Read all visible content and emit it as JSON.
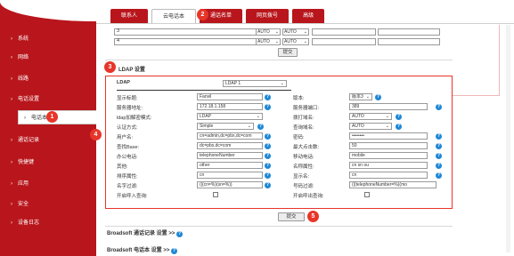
{
  "sidebar": {
    "items": [
      {
        "label": "系统",
        "arrow": "›"
      },
      {
        "label": "网络",
        "arrow": "›"
      },
      {
        "label": "线路",
        "arrow": "›"
      },
      {
        "label": "电话设置",
        "arrow": "›"
      },
      {
        "label": "电话本",
        "arrow": "›"
      },
      {
        "label": "通话记录",
        "arrow": "›"
      },
      {
        "label": "快捷键",
        "arrow": "›"
      },
      {
        "label": "应用",
        "arrow": "›"
      },
      {
        "label": "安全",
        "arrow": "›"
      },
      {
        "label": "设备日志",
        "arrow": "›"
      }
    ]
  },
  "tabs": [
    "联系人",
    "云电话本",
    "通话名单",
    "网页拨号",
    "高级"
  ],
  "markers": [
    "1",
    "2",
    "3",
    "4",
    "5"
  ],
  "top_rows": {
    "rows": [
      {
        "num": "3",
        "sel1": "AUTO",
        "sel2": "AUTO"
      },
      {
        "num": "4",
        "sel1": "AUTO",
        "sel2": "AUTO"
      }
    ],
    "submit": "提交"
  },
  "ldap": {
    "title": "LDAP 设置",
    "selector_label": "LDAP",
    "selector_value": "LDAP 1",
    "left": [
      {
        "label": "显示标题:",
        "value": "Fanvil"
      },
      {
        "label": "服务器地址:",
        "value": "172.18.1.158"
      },
      {
        "label": "ldap加解密模式:",
        "value": "LDAP"
      },
      {
        "label": "认证方式:",
        "value": "Simple"
      },
      {
        "label": "用户名:",
        "value": "cn=admin,dc=pbx,dc=com"
      },
      {
        "label": "查找Base:",
        "value": "dc=pbx,dc=com"
      },
      {
        "label": "办公电话:",
        "value": "telephoneNumber"
      },
      {
        "label": "其他:",
        "value": "other"
      },
      {
        "label": "排序属性:",
        "value": "cn"
      },
      {
        "label": "名字过滤:",
        "value": "(|(cn=%)(sn=%))"
      },
      {
        "label": "开启呼入查询:",
        "value": ""
      }
    ],
    "right": [
      {
        "label": "版本:",
        "value": "版本3"
      },
      {
        "label": "服务器端口:",
        "value": "389"
      },
      {
        "label": "拨打域名:",
        "value": "AUTO"
      },
      {
        "label": "查询域名:",
        "value": "AUTO"
      },
      {
        "label": "密码:",
        "value": "••••••••"
      },
      {
        "label": "最大点击数:",
        "value": "50"
      },
      {
        "label": "移动电话:",
        "value": "mobile"
      },
      {
        "label": "名称属性:",
        "value": "cn sn ou"
      },
      {
        "label": "显示名:",
        "value": "cn"
      },
      {
        "label": "号码过滤:",
        "value": "(|(telephoneNumber=%)(mo"
      },
      {
        "label": "开启呼出查询:",
        "value": ""
      }
    ],
    "submit": "提交"
  },
  "footers": [
    {
      "label": "Broadsoft 通话记录 设置 >>"
    },
    {
      "label": "Broadsoft 电话本 设置 >>"
    }
  ],
  "help_glyph": "?",
  "colors": {
    "sidebar": "#b8161c",
    "marker": "#e8352a",
    "help": "#1e88d6"
  }
}
